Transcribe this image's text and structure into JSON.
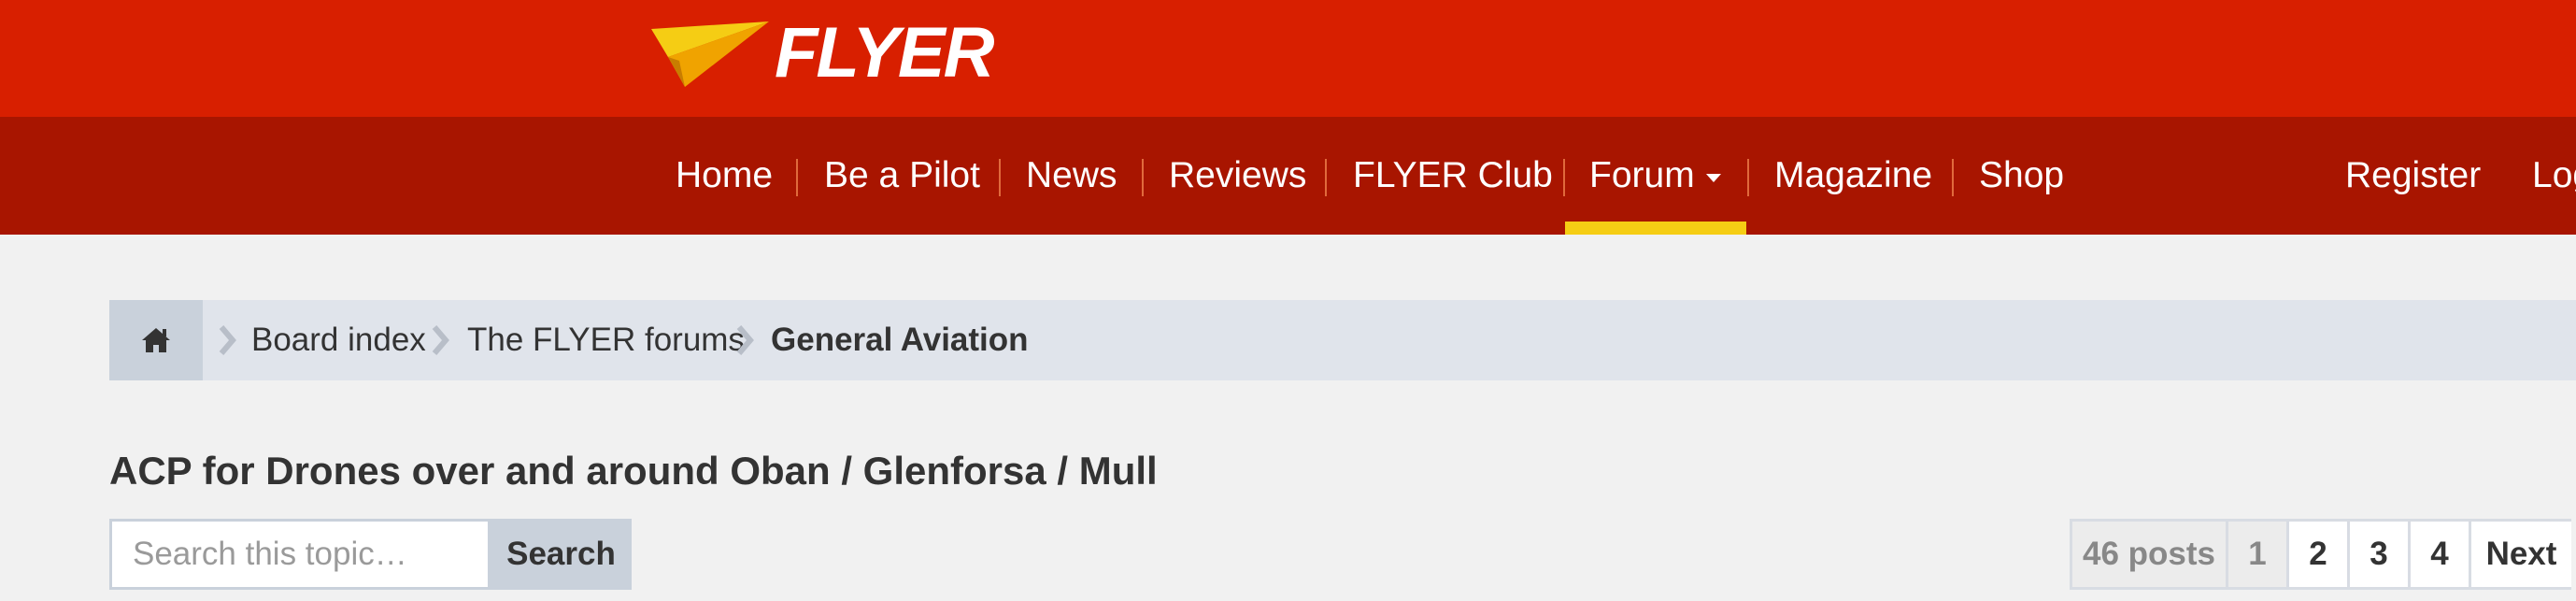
{
  "brand": {
    "name": "FLYER",
    "colors": {
      "primary": "#d81f00",
      "nav": "#a81500",
      "accent": "#f5cd14"
    }
  },
  "nav": {
    "items": [
      {
        "label": "Home"
      },
      {
        "label": "Be a Pilot"
      },
      {
        "label": "News"
      },
      {
        "label": "Reviews"
      },
      {
        "label": "FLYER Club"
      },
      {
        "label": "Forum",
        "active": true,
        "has_dropdown": true
      },
      {
        "label": "Magazine"
      },
      {
        "label": "Shop"
      }
    ],
    "register": "Register",
    "login": "Log"
  },
  "breadcrumb": {
    "home_icon": "home-icon",
    "items": [
      {
        "label": "Board index"
      },
      {
        "label": "The FLYER forums"
      },
      {
        "label": "General Aviation"
      }
    ]
  },
  "topic": {
    "title": "ACP for Drones over and around Oban / Glenforsa / Mull"
  },
  "search": {
    "placeholder": "Search this topic…",
    "button": "Search"
  },
  "pagination": {
    "count": "46 posts",
    "pages": [
      "1",
      "2",
      "3",
      "4"
    ],
    "current": "1",
    "next": "Next"
  }
}
